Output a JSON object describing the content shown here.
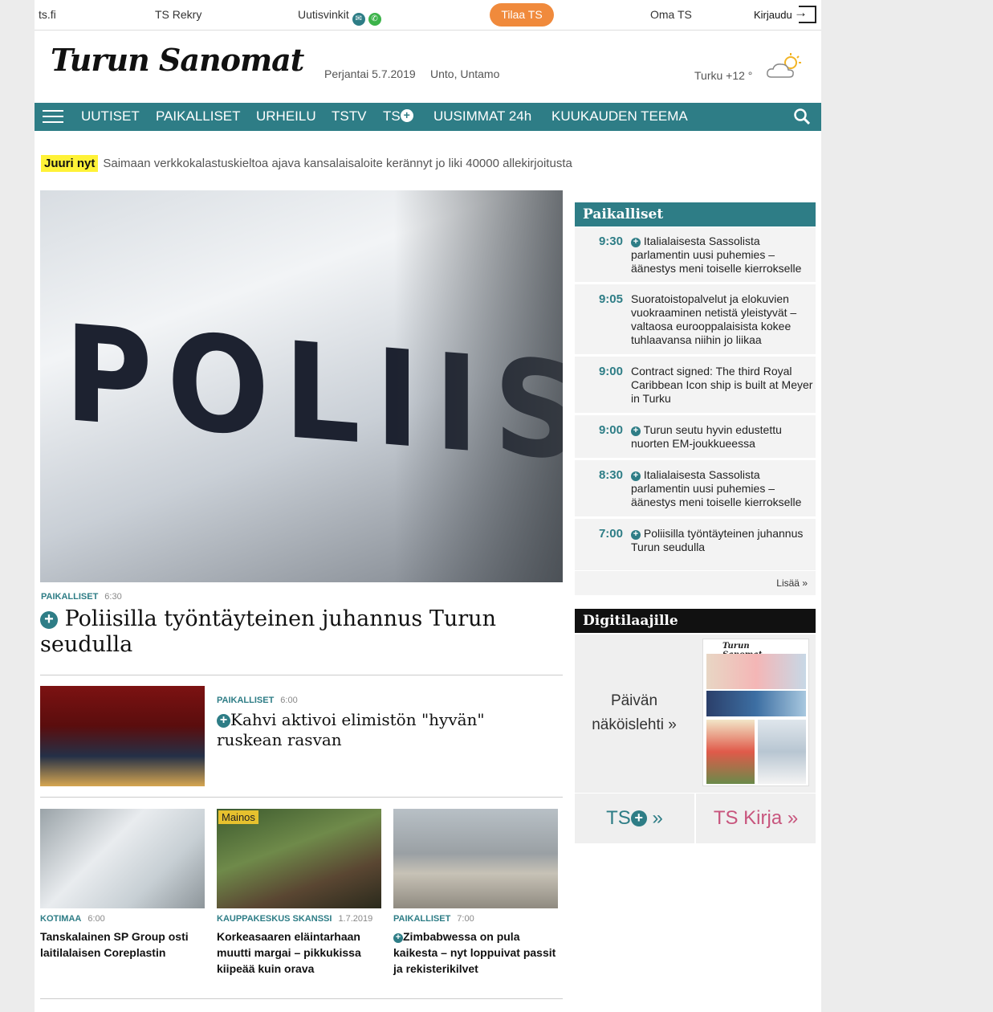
{
  "topbar": {
    "links": [
      "ts.fi",
      "TS Rekry",
      "Uutisvinkit",
      "Oma TS"
    ],
    "subscribe": "Tilaa TS",
    "login": "Kirjaudu"
  },
  "masthead": {
    "logo_text": "Turun Sanomat",
    "date": "Perjantai 5.7.2019",
    "name_day": "Unto, Untamo",
    "weather": "Turku +12 °"
  },
  "nav": {
    "items": [
      "UUTISET",
      "PAIKALLISET",
      "URHEILU",
      "TSTV",
      "TS",
      "UUSIMMAT 24h",
      "KUUKAUDEN TEEMA"
    ]
  },
  "breaking": {
    "tag": "Juuri nyt",
    "text": "Saimaan verkkokalastuskieltoa ajava kansalaisaloite kerännyt jo liki 40000 allekirjoitusta"
  },
  "hero": {
    "image_text": "POLIISI",
    "category": "PAIKALLISET",
    "time": "6:30",
    "title": "Poliisilla työntäyteinen juhannus Turun seudulla"
  },
  "article2": {
    "category": "PAIKALLISET",
    "time": "6:00",
    "title": "Kahvi aktivoi elimistön \"hyvän\" ruskean rasvan"
  },
  "cards": [
    {
      "category": "KOTIMAA",
      "time": "6:00",
      "title": "Tanskalainen SP Group osti laitilalaisen Coreplastin",
      "plus": false
    },
    {
      "badge": "Mainos",
      "category": "KAUPPAKESKUS SKANSSI",
      "time": "1.7.2019",
      "title": "Korkeasaaren eläintarhaan muutti margai – pikkukissa kiipeää kuin orava",
      "plus": false
    },
    {
      "category": "PAIKALLISET",
      "time": "7:00",
      "title": "Zimbabwessa on pula kaikesta – nyt loppuivat passit ja rekisterikilvet",
      "plus": true
    }
  ],
  "sidebar": {
    "heading": "Paikalliset",
    "items": [
      {
        "time": "9:30",
        "text": "Italialaisesta Sassolista parlamentin uusi puhemies – äänestys meni toiselle kierrokselle",
        "plus": true
      },
      {
        "time": "9:05",
        "text": "Suoratoistopalvelut ja elokuvien vuokraaminen netistä yleistyvät – valtaosa eurooppalaisista kokee tuhlaavansa niihin jo liikaa",
        "plus": false
      },
      {
        "time": "9:00",
        "text": "Contract signed: The third Royal Caribbean Icon ship is built at Meyer in Turku",
        "plus": false
      },
      {
        "time": "9:00",
        "text": "Turun seutu hyvin edustettu nuorten EM-joukkueessa",
        "plus": true
      },
      {
        "time": "8:30",
        "text": "Italialaisesta Sassolista parlamentin uusi puhemies – äänestys meni toiselle kierrokselle",
        "plus": true
      },
      {
        "time": "7:00",
        "text": "Poliisilla työntäyteinen juhannus Turun seudulla",
        "plus": true
      }
    ],
    "more": "Lisää »"
  },
  "digi": {
    "heading": "Digitilaajille",
    "label_line1": "Päivän",
    "label_line2": "näköislehti »",
    "paper_logo": "Turun Sanomat"
  },
  "bottom_boxes": {
    "tsplus_text": "TS",
    "tsplus_arrow": "»",
    "tskirja": "TS Kirja »"
  },
  "colors": {
    "accent": "#2e7d86",
    "subscribe": "#f08a3c",
    "highlight": "#fff237",
    "kirja": "#c8557d"
  }
}
